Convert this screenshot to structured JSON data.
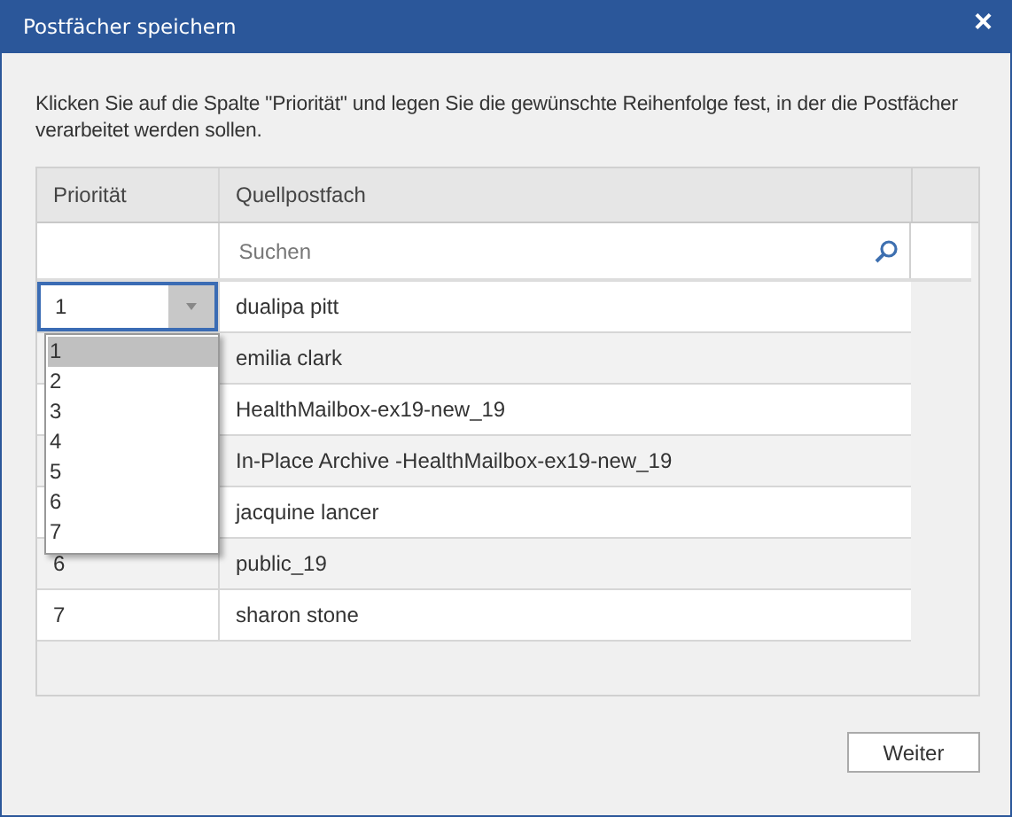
{
  "window": {
    "title": "Postfächer speichern",
    "close": "×"
  },
  "instruction": "Klicken Sie auf die Spalte \"Priorität\" und legen Sie die gewünschte Reihenfolge fest, in der die Postfächer verarbeitet werden sollen.",
  "table": {
    "columns": [
      "Priorität",
      "Quellpostfach"
    ],
    "search": {
      "placeholder": "Suchen"
    },
    "rows": [
      {
        "priority": "1",
        "mailbox": "dualipa pitt",
        "editing": true
      },
      {
        "mailbox": "emilia clark"
      },
      {
        "mailbox": "HealthMailbox-ex19-new_19"
      },
      {
        "mailbox": "In-Place Archive -HealthMailbox-ex19-new_19"
      },
      {
        "mailbox": "jacquine lancer"
      },
      {
        "priority": "6",
        "mailbox": "public_19"
      },
      {
        "priority": "7",
        "mailbox": "sharon stone"
      }
    ],
    "dropdown": {
      "options": [
        {
          "label": "1",
          "selected": true
        },
        {
          "label": "2",
          "selected": false
        },
        {
          "label": "3",
          "selected": false
        },
        {
          "label": "4",
          "selected": false
        },
        {
          "label": "5",
          "selected": false
        },
        {
          "label": "6",
          "selected": false
        },
        {
          "label": "7",
          "selected": false
        }
      ]
    }
  },
  "buttons": [
    "Weiter"
  ]
}
